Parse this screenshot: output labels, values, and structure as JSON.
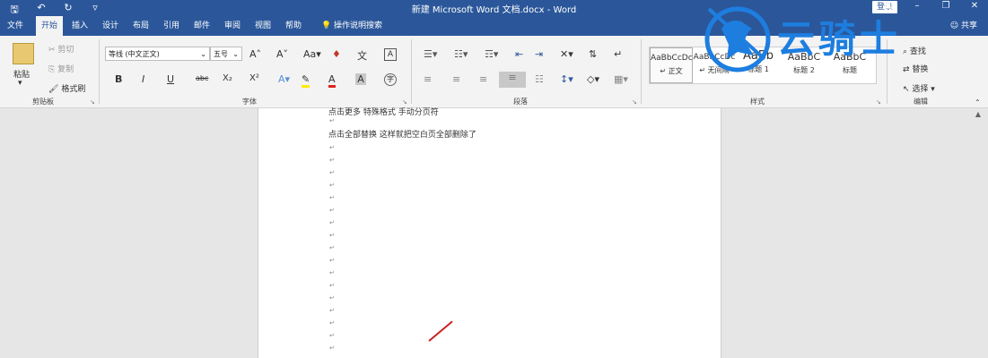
{
  "window": {
    "title": "新建 Microsoft Word 文档.docx - Word",
    "login": "登录"
  },
  "qat": {
    "save_icon": "save-icon",
    "undo_icon": "undo-icon",
    "redo_icon": "redo-icon",
    "more_icon": "customize-icon"
  },
  "tabs": [
    "文件",
    "开始",
    "插入",
    "设计",
    "布局",
    "引用",
    "邮件",
    "审阅",
    "视图",
    "帮助"
  ],
  "tell_me": "操作说明搜索",
  "share": "共享",
  "clipboard": {
    "paste": "粘贴",
    "cut": "剪切",
    "copy": "复制",
    "format_painter": "格式刷",
    "label": "剪贴板"
  },
  "font": {
    "name": "等线 (中文正文)",
    "size": "五号",
    "label": "字体",
    "bold": "B",
    "italic": "I",
    "underline": "U",
    "strike": "abc",
    "sub": "X₂",
    "sup": "X²"
  },
  "paragraph": {
    "label": "段落"
  },
  "styles": {
    "label": "样式",
    "items": [
      {
        "sample": "AaBbCcDc",
        "name": "↵ 正文"
      },
      {
        "sample": "AaBbCcDc",
        "name": "↵ 无间隔"
      },
      {
        "sample": "AaBb",
        "name": "标题 1"
      },
      {
        "sample": "AaBbC",
        "name": "标题 2"
      },
      {
        "sample": "AaBbC",
        "name": "标题"
      }
    ]
  },
  "editing": {
    "find": "查找",
    "replace": "替换",
    "select": "选择",
    "label": "编辑"
  },
  "document": {
    "line1": "点击更多  特殊格式  手动分页符",
    "line2": "点击全部替换  这样就把空白页全部删除了"
  },
  "watermark": {
    "text": "云骑士"
  },
  "colors": {
    "accent": "#2b579a",
    "watermark": "#1d7ee0"
  }
}
